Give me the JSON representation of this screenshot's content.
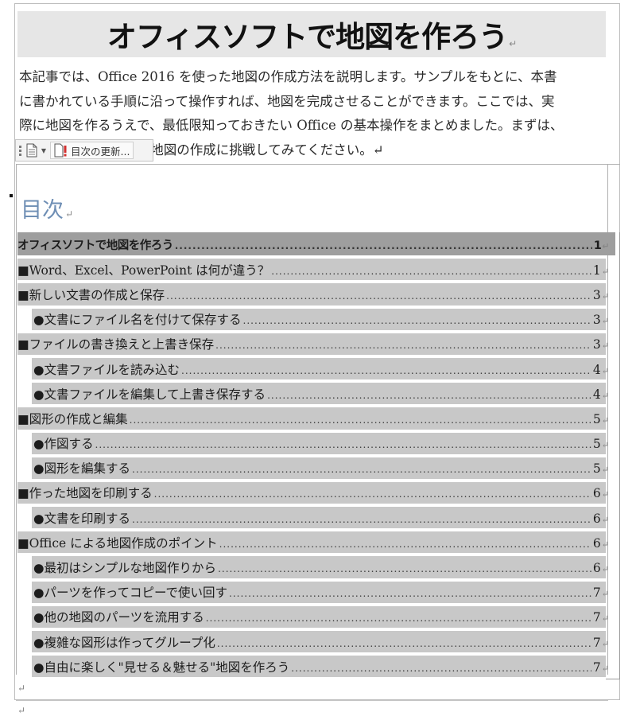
{
  "document": {
    "title": "オフィスソフトで地図を作ろう",
    "paragraph_mark": "↵",
    "intro_lines": [
      "本記事では、Office 2016 を使った地図の作成方法を説明します。サンプルをもとに、本書",
      "に書かれている手順に沿って操作すれば、地図を完成させることができます。ここでは、実",
      "際に地図を作るうえで、最低限知っておきたい Office の基本操作をまとめました。まずは、",
      "                たあとで、地図の作成に挑戦してみてください。↵"
    ]
  },
  "toc_toolbar": {
    "update_label": "目次の更新...",
    "icons": [
      "drag-grip-icon",
      "document-icon",
      "dropdown-arrow-icon",
      "update-warning-icon"
    ]
  },
  "toc": {
    "heading": "目次",
    "entries": [
      {
        "label": "オフィスソフトで地図を作ろう",
        "page": "1",
        "level": 0
      },
      {
        "label": "■Word、Excel、PowerPoint は何が違う？",
        "page": "1",
        "level": 1
      },
      {
        "label": "■新しい文書の作成と保存",
        "page": "3",
        "level": 1
      },
      {
        "label": "●文書にファイル名を付けて保存する",
        "page": "3",
        "level": 2
      },
      {
        "label": "■ファイルの書き換えと上書き保存",
        "page": "3",
        "level": 1
      },
      {
        "label": "●文書ファイルを読み込む",
        "page": "4",
        "level": 2
      },
      {
        "label": "●文書ファイルを編集して上書き保存する",
        "page": "4",
        "level": 2
      },
      {
        "label": "■図形の作成と編集",
        "page": "5",
        "level": 1
      },
      {
        "label": "●作図する",
        "page": "5",
        "level": 2
      },
      {
        "label": "●図形を編集する",
        "page": "5",
        "level": 2
      },
      {
        "label": "■作った地図を印刷する",
        "page": "6",
        "level": 1
      },
      {
        "label": "●文書を印刷する",
        "page": "6",
        "level": 2
      },
      {
        "label": "■Office による地図作成のポイント",
        "page": "6",
        "level": 1
      },
      {
        "label": "●最初はシンプルな地図作りから",
        "page": "6",
        "level": 2
      },
      {
        "label": "●パーツを作ってコピーで使い回す",
        "page": "7",
        "level": 2
      },
      {
        "label": "●他の地図のパーツを流用する",
        "page": "7",
        "level": 2
      },
      {
        "label": "●複雑な図形は作ってグループ化",
        "page": "7",
        "level": 2
      },
      {
        "label": "●自由に楽しく\"見せる＆魅せる\"地図を作ろう",
        "page": "7",
        "level": 2
      }
    ]
  },
  "colors": {
    "title_band": "#e6e6e6",
    "toc_heading": "#6f8fb5",
    "field_shading": "#c8c8c8",
    "field_shading_selected": "#9e9e9e"
  }
}
